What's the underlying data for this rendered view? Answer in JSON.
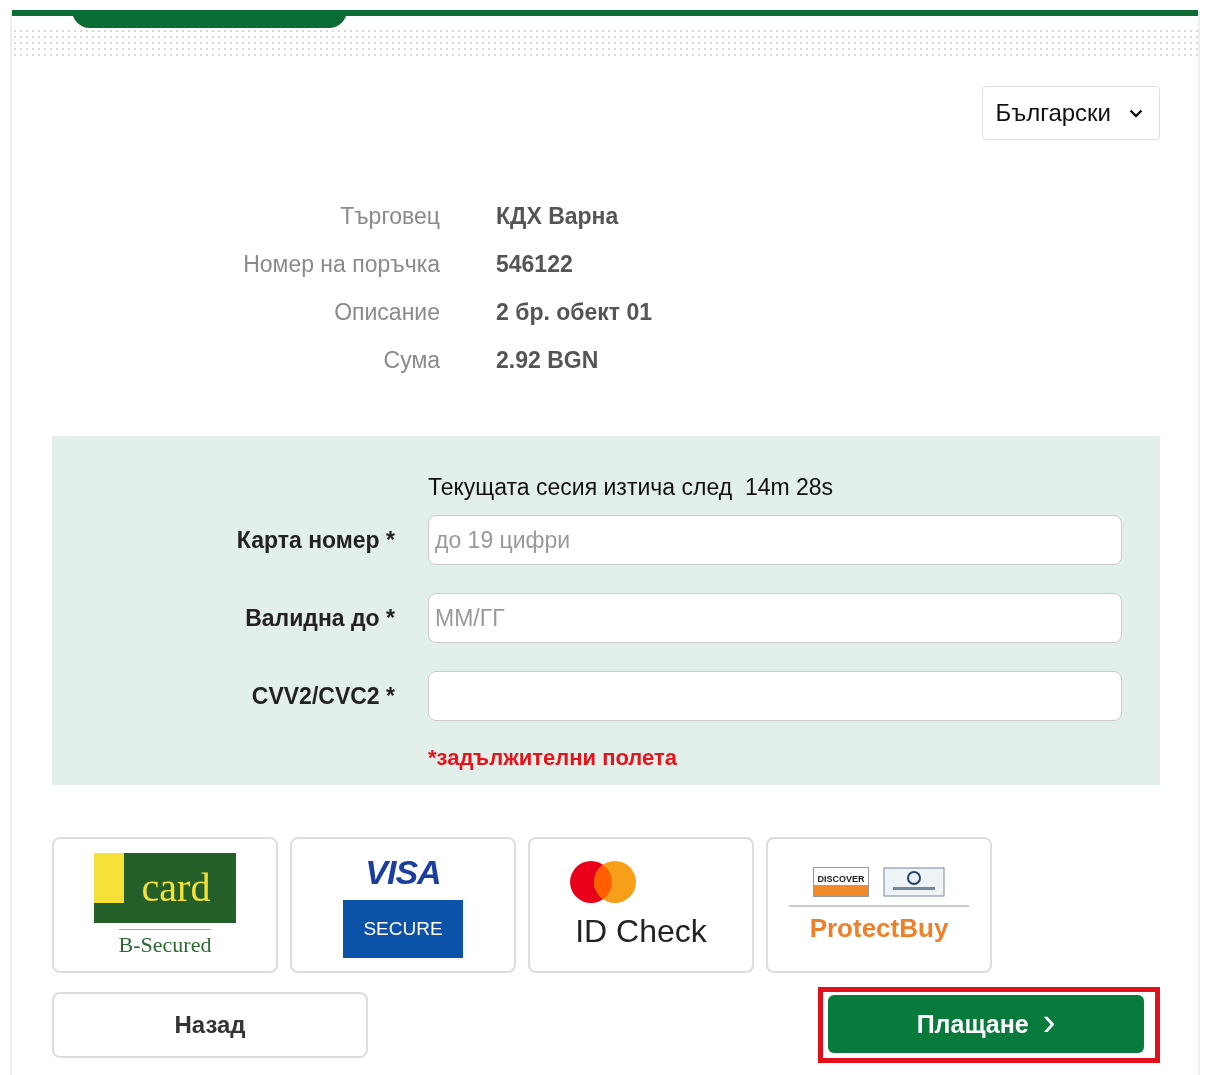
{
  "language_select": {
    "value": "Български"
  },
  "order_details": [
    {
      "label": "Търговец",
      "value": "КДХ Варна"
    },
    {
      "label": "Номер на поръчка",
      "value": "546122"
    },
    {
      "label": "Описание",
      "value": "2 бр. обект 01"
    },
    {
      "label": "Сума",
      "value": "2.92 BGN"
    }
  ],
  "session": {
    "text": "Текущата сесия изтича след",
    "remaining": "14m 28s"
  },
  "fields": [
    {
      "label": "Карта номер *",
      "placeholder": "до 19 цифри"
    },
    {
      "label": "Валидна до *",
      "placeholder": "ММ/ГГ"
    },
    {
      "label": "CVV2/CVC2 *"
    }
  ],
  "required_note": "*задължителни полета",
  "security_logos": [
    {
      "kind": "bcard",
      "texts": [
        "card",
        "B-Secured"
      ]
    },
    {
      "kind": "visa",
      "texts": [
        "VISA",
        "SECURE"
      ]
    },
    {
      "kind": "mastercard",
      "texts": [
        "ID Check"
      ]
    },
    {
      "kind": "protectbuy",
      "texts": [
        "DISCOVER",
        "ProtectBuy"
      ]
    }
  ],
  "buttons": {
    "back": "Назад",
    "pay": {
      "label": "Плащане",
      "icon": "›",
      "highlighted": true
    }
  }
}
